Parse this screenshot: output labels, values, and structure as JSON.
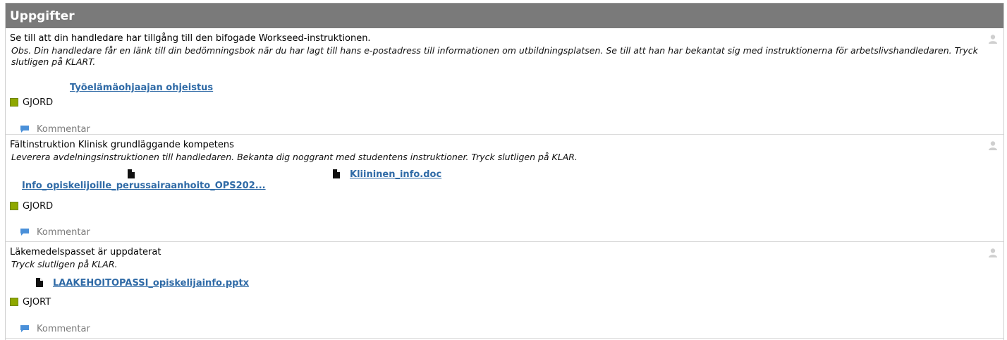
{
  "panel": {
    "title": "Uppgifter"
  },
  "tasks": [
    {
      "title": "Se till att din handledare har tillgång till den bifogade Workseed-instruktionen.",
      "description": "Obs. Din handledare får en länk till din bedömningsbok när du har lagt till hans e-postadress till informationen om utbildningsplatsen. Se till att han har bekantat sig med instruktionerna för arbetslivshandledaren. Tryck slutligen på KLART.",
      "attachments": [
        "Työelämäohjaajan ohjeistus"
      ],
      "status": "GJORD",
      "comment_label": "Kommentar"
    },
    {
      "title": "Fältinstruktion Klinisk grundläggande kompetens",
      "description": "Leverera avdelningsinstruktionen till handledaren. Bekanta dig noggrant med studentens instruktioner. Tryck slutligen på KLAR.",
      "attachments": [
        "Info_opiskelijoille_perussairaanhoito_OPS202...",
        "Kliininen_info.doc"
      ],
      "status": "GJORD",
      "comment_label": "Kommentar"
    },
    {
      "title": "Läkemedelspasset är uppdaterat",
      "description": "Tryck slutligen på KLAR.",
      "attachments": [
        "LAAKEHOITOPASSI_opiskelijainfo.pptx"
      ],
      "status": "GJORT",
      "comment_label": "Kommentar"
    }
  ],
  "icons": {
    "person": "person-icon",
    "file": "file-icon",
    "comment": "comment-icon",
    "status": "status-square-icon"
  },
  "colors": {
    "header_bg": "#7a7a7a",
    "link": "#2f6aa6",
    "status_done": "#8fa800",
    "comment_icon": "#4a90d9"
  }
}
